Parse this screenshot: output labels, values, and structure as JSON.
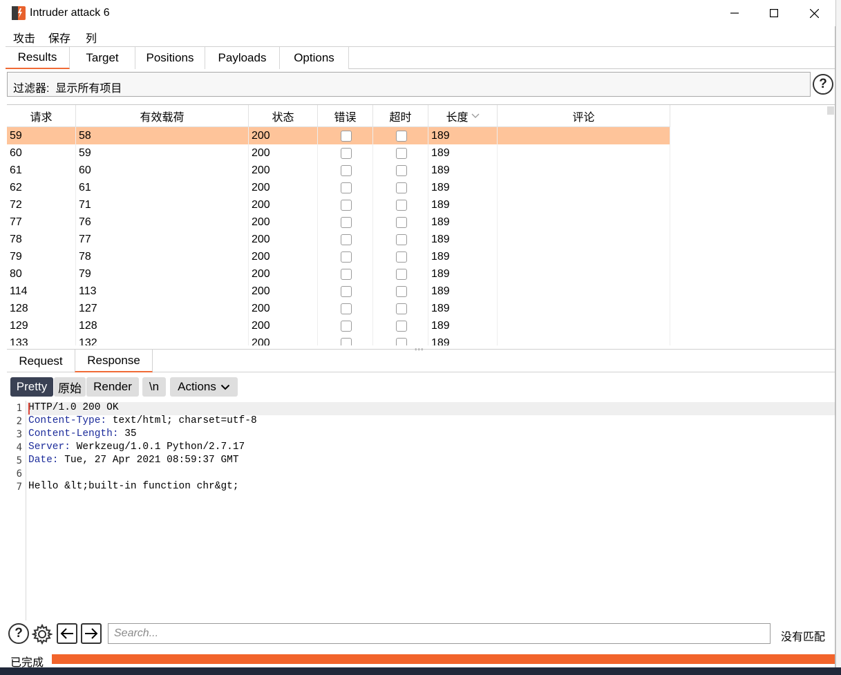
{
  "window": {
    "title": "Intruder attack 6"
  },
  "menu": [
    "攻击",
    "保存",
    "列"
  ],
  "tabs": [
    "Results",
    "Target",
    "Positions",
    "Payloads",
    "Options"
  ],
  "filter": {
    "label": "过滤器:",
    "value": "显示所有项目"
  },
  "table": {
    "headers": [
      "请求",
      "有效载荷",
      "状态",
      "错误",
      "超时",
      "长度",
      "评论"
    ],
    "rows": [
      {
        "request": "59",
        "payload": "58",
        "status": "200",
        "length": "189",
        "selected": true
      },
      {
        "request": "60",
        "payload": "59",
        "status": "200",
        "length": "189"
      },
      {
        "request": "61",
        "payload": "60",
        "status": "200",
        "length": "189"
      },
      {
        "request": "62",
        "payload": "61",
        "status": "200",
        "length": "189"
      },
      {
        "request": "72",
        "payload": "71",
        "status": "200",
        "length": "189"
      },
      {
        "request": "77",
        "payload": "76",
        "status": "200",
        "length": "189"
      },
      {
        "request": "78",
        "payload": "77",
        "status": "200",
        "length": "189"
      },
      {
        "request": "79",
        "payload": "78",
        "status": "200",
        "length": "189"
      },
      {
        "request": "80",
        "payload": "79",
        "status": "200",
        "length": "189"
      },
      {
        "request": "114",
        "payload": "113",
        "status": "200",
        "length": "189"
      },
      {
        "request": "128",
        "payload": "127",
        "status": "200",
        "length": "189"
      },
      {
        "request": "129",
        "payload": "128",
        "status": "200",
        "length": "189"
      },
      {
        "request": "133",
        "payload": "132",
        "status": "200",
        "length": "189"
      }
    ]
  },
  "message_tabs": [
    "Request",
    "Response"
  ],
  "toolbar": {
    "pretty": "Pretty",
    "raw": "原始",
    "render": "Render",
    "newline": "\\n",
    "actions": "Actions"
  },
  "response": {
    "lines": [
      {
        "num": "1",
        "key": "",
        "text": "HTTP/1.0 200 OK"
      },
      {
        "num": "2",
        "key": "Content-Type:",
        "text": " text/html; charset=utf-8"
      },
      {
        "num": "3",
        "key": "Content-Length:",
        "text": " 35"
      },
      {
        "num": "4",
        "key": "Server:",
        "text": " Werkzeug/1.0.1 Python/2.7.17"
      },
      {
        "num": "5",
        "key": "Date:",
        "text": " Tue, 27 Apr 2021 08:59:37 GMT"
      },
      {
        "num": "6",
        "key": "",
        "text": ""
      },
      {
        "num": "7",
        "key": "",
        "text": "Hello &lt;built-in function chr&gt;"
      }
    ]
  },
  "search": {
    "placeholder": "Search...",
    "result": "没有匹配"
  },
  "status": {
    "text": "已完成",
    "progress": 1.0
  },
  "colors": {
    "accent": "#f06a35",
    "selected_row": "#fec49a",
    "header_key": "#1a2a9a",
    "progress": "#f2642b"
  }
}
